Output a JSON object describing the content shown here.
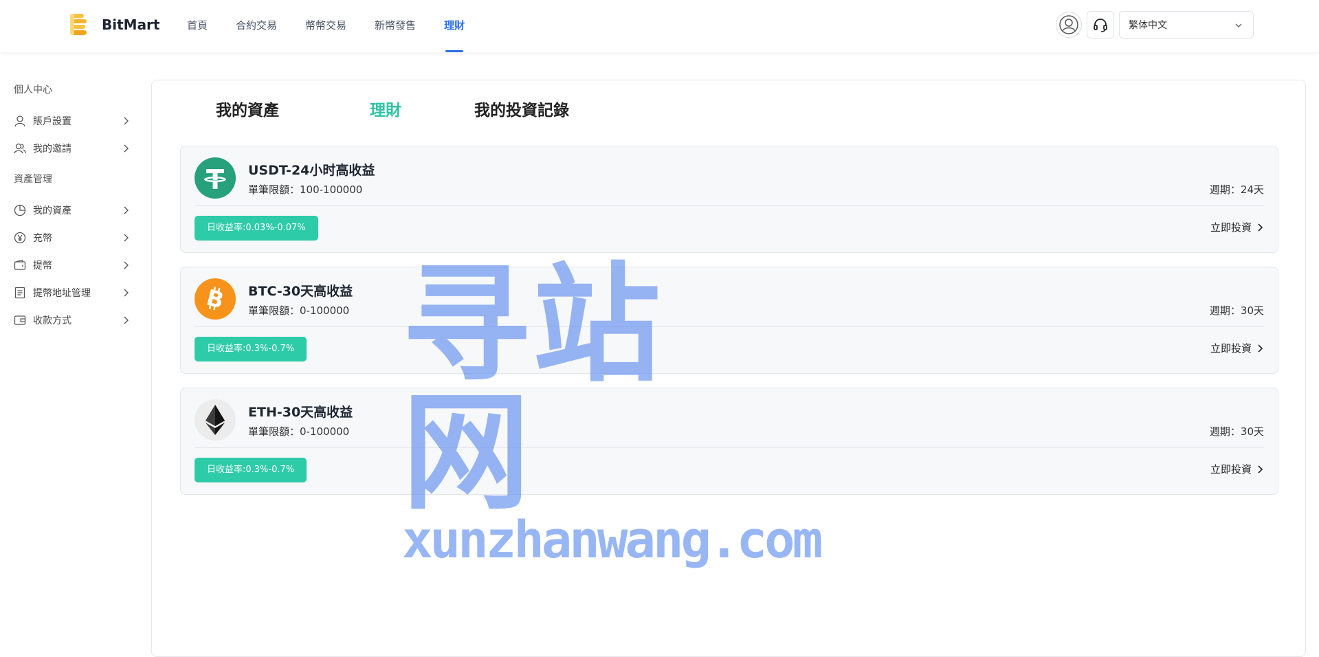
{
  "brand": {
    "name": "BitMart"
  },
  "nav": [
    {
      "label": "首頁",
      "active": false
    },
    {
      "label": "合約交易",
      "active": false
    },
    {
      "label": "幣幣交易",
      "active": false
    },
    {
      "label": "新幣發售",
      "active": false
    },
    {
      "label": "理財",
      "active": true
    }
  ],
  "header": {
    "language": "繁体中文"
  },
  "sidebar": {
    "group1": "個人中心",
    "group1_items": [
      {
        "label": "賬戶設置",
        "icon": "user-icon"
      },
      {
        "label": "我的邀請",
        "icon": "users-icon"
      }
    ],
    "group2": "資產管理",
    "group2_items": [
      {
        "label": "我的資產",
        "icon": "pie-chart-icon"
      },
      {
        "label": "充幣",
        "icon": "yen-coin-icon"
      },
      {
        "label": "提幣",
        "icon": "wallet-icon"
      },
      {
        "label": "提幣地址管理",
        "icon": "document-icon"
      },
      {
        "label": "收款方式",
        "icon": "card-wallet-icon"
      }
    ]
  },
  "tabs": [
    {
      "label": "我的資產",
      "active": false
    },
    {
      "label": "理財",
      "active": true
    },
    {
      "label": "我的投資記錄",
      "active": false
    }
  ],
  "products": [
    {
      "coin": "USDT",
      "title": "USDT-24小时高收益",
      "limit": "單筆限額：100-100000",
      "period": "週期：24天",
      "rate": "日收益率:0.03%-0.07%",
      "action": "立即投資",
      "color": "#26a17b"
    },
    {
      "coin": "BTC",
      "title": "BTC-30天高收益",
      "limit": "單筆限額：0-100000",
      "period": "週期：30天",
      "rate": "日收益率:0.3%-0.7%",
      "action": "立即投資",
      "color": "#f7931a"
    },
    {
      "coin": "ETH",
      "title": "ETH-30天高收益",
      "limit": "單筆限額：0-100000",
      "period": "週期：30天",
      "rate": "日收益率:0.3%-0.7%",
      "action": "立即投資",
      "color": "#ececec"
    }
  ],
  "watermark": {
    "cn": "寻站网",
    "en": "xunzhanwang.com"
  },
  "colors": {
    "accent": "#2b6fe6",
    "green": "#2ecba8",
    "tab_active": "#2ec4a5"
  }
}
